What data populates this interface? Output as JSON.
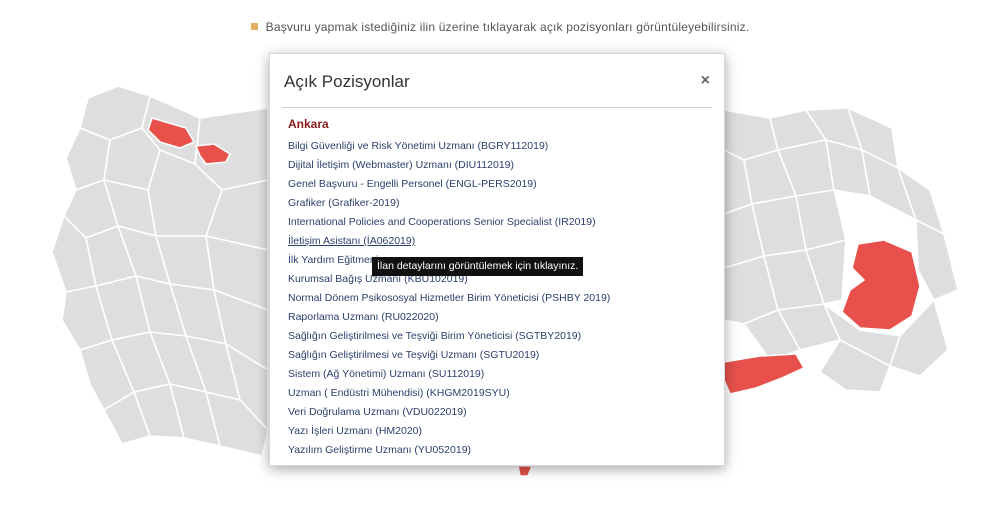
{
  "instruction": {
    "text": "Başvuru yapmak istediğiniz ilin üzerine tıklayarak açık pozisyonları görüntüleyebilirsiniz.",
    "bullet_color": "#e0b060"
  },
  "map": {
    "default_fill": "#dedede",
    "highlight_fill": "#e8514b"
  },
  "modal": {
    "title": "Açık Pozisyonlar",
    "close_symbol": "×",
    "city": "Ankara",
    "jobs": [
      "Bilgi Güvenliği ve Risk Yönetimi Uzmanı (BGRY112019)",
      "Dijital İletişim (Webmaster) Uzmanı (DIU112019)",
      "Genel Başvuru - Engelli Personel (ENGL-PERS2019)",
      "Grafiker (Grafiker-2019)",
      "International Policies and Cooperations Senior Specialist (IR2019)",
      "İletişim Asistanı (İA062019)",
      "İlk Yardım Eğitmeni",
      "Kurumsal Bağış Uzmanı (KBU102019)",
      "Normal Dönem Psikososyal Hizmetler Birim Yöneticisi (PSHBY 2019)",
      "Raporlama Uzmanı (RU022020)",
      "Sağlığın Geliştirilmesi ve Teşviği Birim Yöneticisi (SGTBY2019)",
      "Sağlığın Geliştirilmesi ve Teşviği Uzmanı (SGTU2019)",
      "Sistem (Ağ Yönetimi) Uzmanı (SU112019)",
      "Uzman ( Endüstri Mühendisi) (KHGM2019SYU)",
      "Veri Doğrulama Uzmanı (VDU022019)",
      "Yazı İşleri Uzmanı (HM2020)",
      "Yazılım Geliştirme Uzmanı (YU052019)"
    ]
  },
  "tooltip": {
    "text": "İlan detaylarını görüntülemek için tıklayınız."
  }
}
